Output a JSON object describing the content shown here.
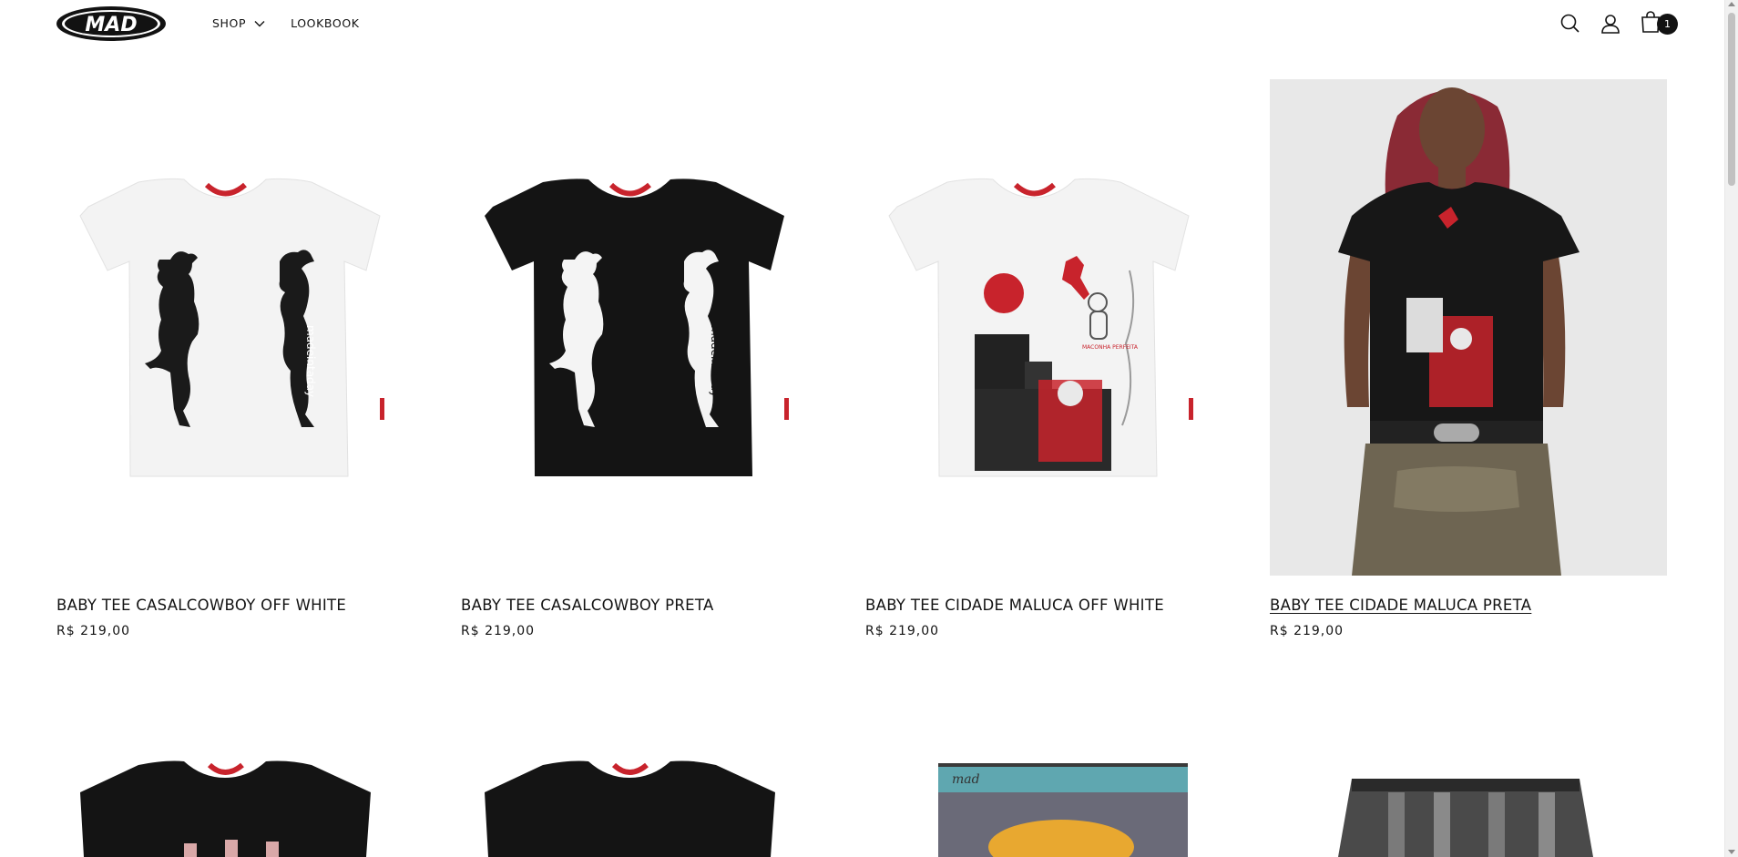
{
  "brand": {
    "logo_text": "MAD"
  },
  "nav": {
    "shop_label": "SHOP",
    "lookbook_label": "LOOKBOOK"
  },
  "header": {
    "search_icon": "search-icon",
    "account_icon": "account-icon",
    "cart_icon": "cart-icon",
    "cart_count": "1"
  },
  "products": [
    {
      "title": "BABY TEE CASALCOWBOY OFF WHITE",
      "price": "R$ 219,00",
      "image": "white tee with black cowboy silhouettes"
    },
    {
      "title": "BABY TEE CASALCOWBOY PRETA",
      "price": "R$ 219,00",
      "image": "black tee with white cowboy silhouettes"
    },
    {
      "title": "BABY TEE CIDADE MALUCA OFF WHITE",
      "price": "R$ 219,00",
      "image": "white tee with city collage print"
    },
    {
      "title": "BABY TEE CIDADE MALUCA PRETA",
      "price": "R$ 219,00",
      "image": "model wearing black tee with city collage print"
    }
  ],
  "colors": {
    "text": "#121212",
    "accent_red": "#c8232c",
    "background": "#ffffff"
  }
}
